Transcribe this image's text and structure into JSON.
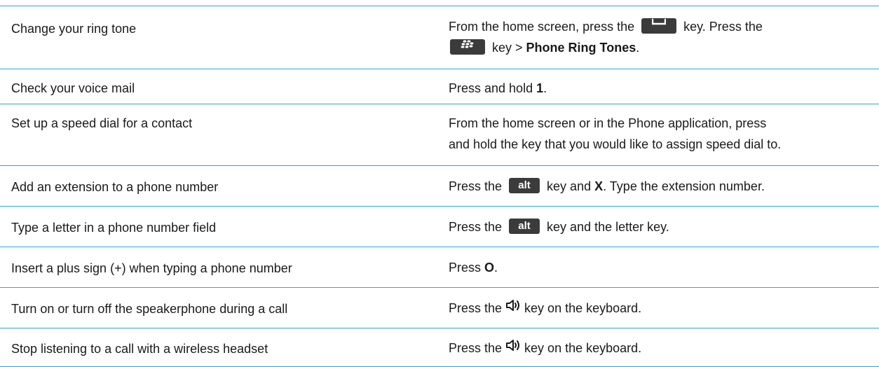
{
  "rows": [
    {
      "task": "Change your ring tone",
      "how": {
        "p1": "From the home screen, press the",
        "p2": "key. Press the",
        "p3": "key >",
        "bold": "Phone Ring Tones",
        "p4": "."
      },
      "icons": [
        "send-key-icon",
        "blackberry-menu-key-icon"
      ]
    },
    {
      "task": "Check your voice mail",
      "how": {
        "p1": "Press and hold",
        "bold": "1",
        "p2": "."
      }
    },
    {
      "task": "Set up a speed dial for a contact",
      "how": {
        "line1": "From the home screen or in the Phone application, press",
        "line2": "and hold the key that you would like to assign speed dial to."
      }
    },
    {
      "task": "Add an extension to a phone number",
      "how": {
        "p1": "Press the",
        "key": "alt",
        "p2": "key and",
        "bold": "X",
        "p3": ". Type the extension number."
      }
    },
    {
      "task": "Type a letter in a phone number field",
      "how": {
        "p1": "Press the",
        "key": "alt",
        "p2": "key and the letter key."
      }
    },
    {
      "task": "Insert a plus sign (+) when typing a phone number",
      "how": {
        "p1": "Press",
        "bold": "O",
        "p2": "."
      }
    },
    {
      "task": "Turn on or turn off the speakerphone during a call",
      "how": {
        "p1": "Press the",
        "p2": "key on the keyboard."
      },
      "icons": [
        "speaker-icon"
      ]
    },
    {
      "task": "Stop listening to a call with a wireless headset",
      "how": {
        "p1": "Press the",
        "p2": "key on the keyboard."
      },
      "icons": [
        "speaker-icon"
      ]
    }
  ],
  "colors": {
    "rule": "#2aa6d6",
    "key_bg": "#3b3b3b",
    "text": "#1a1a1a"
  }
}
